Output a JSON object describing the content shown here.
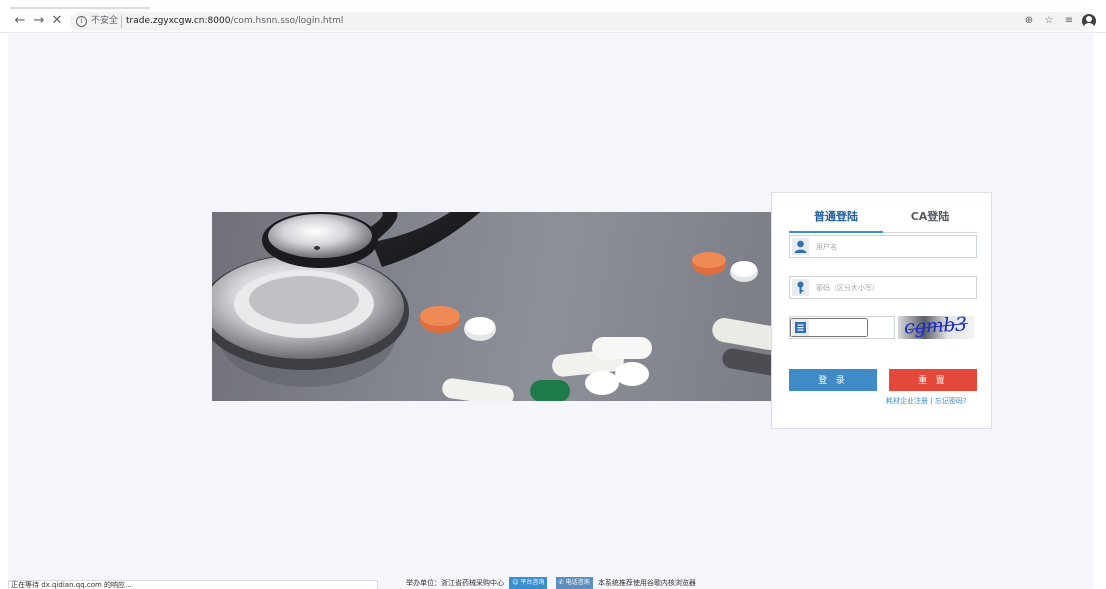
{
  "browser": {
    "back_glyph": "←",
    "forward_glyph": "→",
    "stop_glyph": "✕",
    "security_label": "不安全",
    "url_host": "trade.zgyxcgw.cn:8000",
    "url_path": "/com.hsnn.sso/login.html",
    "zoom_glyph": "⊕",
    "star_glyph": "☆",
    "menu_glyph": "≡"
  },
  "login": {
    "tabs": [
      "普通登陆",
      "CA登陆"
    ],
    "username_placeholder": "用户名",
    "password_placeholder": "密码（区分大小写）",
    "captcha_text": "cgmb3",
    "login_button": "登 录",
    "reset_button": "重 置",
    "register_link": "耗材企业注册",
    "forgot_link": "忘记密码?"
  },
  "footer": {
    "host_label": "举办单位：浙江省药械采购中心",
    "platform_badge": "平台咨询",
    "phone_badge": "电话咨询",
    "recommend": "本系统推荐使用谷歌内核浏览器"
  },
  "status": {
    "text": "正在等待 dx.qidian.qq.com 的响应..."
  },
  "colors": {
    "accent_blue": "#3e8bc8",
    "reset_red": "#e4483a",
    "page_bg": "#f4f6fb"
  }
}
